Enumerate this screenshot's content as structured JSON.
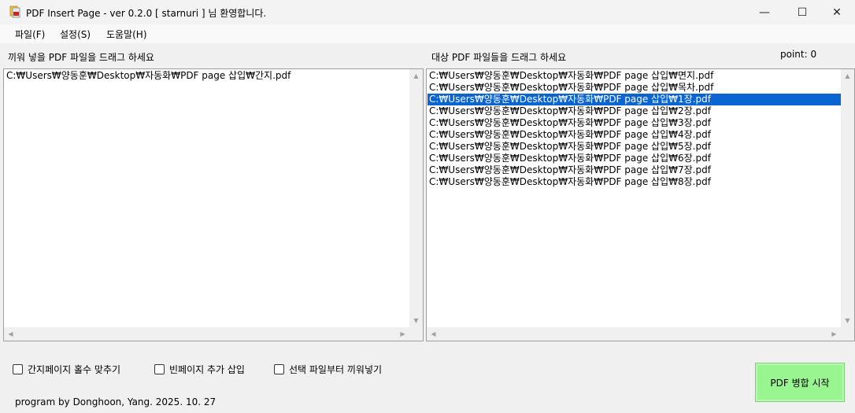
{
  "window": {
    "title": "PDF Insert Page - ver 0.2.0   [ starnuri ] 님 환영합니다.",
    "minimize": "—",
    "maximize": "☐",
    "close": "✕"
  },
  "menu": {
    "file": "파일(F)",
    "settings": "설정(S)",
    "help": "도움말(H)"
  },
  "left_panel": {
    "label": "끼워 넣을 PDF 파일을 드래그 하세요",
    "items": [
      "C:₩Users₩양동훈₩Desktop₩자동화₩PDF page 삽입₩간지.pdf"
    ]
  },
  "right_panel": {
    "label": "대상 PDF 파일들을 드래그 하세요",
    "point_label": "point: 0",
    "selected_index": 2,
    "items": [
      "C:₩Users₩양동훈₩Desktop₩자동화₩PDF page 삽입₩면지.pdf",
      "C:₩Users₩양동훈₩Desktop₩자동화₩PDF page 삽입₩목차.pdf",
      "C:₩Users₩양동훈₩Desktop₩자동화₩PDF page 삽입₩1장.pdf",
      "C:₩Users₩양동훈₩Desktop₩자동화₩PDF page 삽입₩2장.pdf",
      "C:₩Users₩양동훈₩Desktop₩자동화₩PDF page 삽입₩3장.pdf",
      "C:₩Users₩양동훈₩Desktop₩자동화₩PDF page 삽입₩4장.pdf",
      "C:₩Users₩양동훈₩Desktop₩자동화₩PDF page 삽입₩5장.pdf",
      "C:₩Users₩양동훈₩Desktop₩자동화₩PDF page 삽입₩6장.pdf",
      "C:₩Users₩양동훈₩Desktop₩자동화₩PDF page 삽입₩7장.pdf",
      "C:₩Users₩양동훈₩Desktop₩자동화₩PDF page 삽입₩8장.pdf"
    ]
  },
  "options": {
    "odd_pages": "간지페이지 홀수 맞추기",
    "blank_page": "빈페이지 추가 삽입",
    "from_selected": "선택 파일부터 끼워넣기"
  },
  "footer": {
    "credit": "program by Donghoon, Yang.  2025. 10. 27"
  },
  "actions": {
    "start": "PDF 병합 시작"
  },
  "colors": {
    "selection": "#0a64d2",
    "start_button": "#99f590"
  }
}
